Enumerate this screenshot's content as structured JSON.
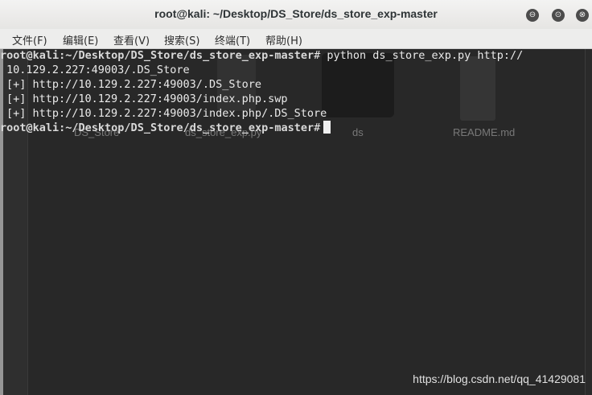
{
  "window": {
    "title": "root@kali: ~/Desktop/DS_Store/ds_store_exp-master",
    "controls": {
      "minimize": "⊖",
      "maximize": "⊙",
      "close": "⊗"
    }
  },
  "menubar": {
    "items": [
      "文件(F)",
      "编辑(E)",
      "查看(V)",
      "搜索(S)",
      "终端(T)",
      "帮助(H)"
    ]
  },
  "desktop_ghost": {
    "labels": [
      "DS_Store",
      "ds_store_exp.py",
      "ds",
      "README.md"
    ]
  },
  "terminal": {
    "prompt_user": "root@kali",
    "prompt_path": ":~/Desktop/DS_Store/ds_store_exp-master",
    "prompt_symbol": "#",
    "command": " python ds_store_exp.py http://",
    "command_wrap": "10.129.2.227:49003/.DS_Store",
    "output": [
      "[+] http://10.129.2.227:49003/.DS_Store",
      "[+] http://10.129.2.227:49003/index.php.swp",
      "[+] http://10.129.2.227:49003/index.php/.DS_Store"
    ]
  },
  "watermark": "https://blog.csdn.net/qq_41429081"
}
